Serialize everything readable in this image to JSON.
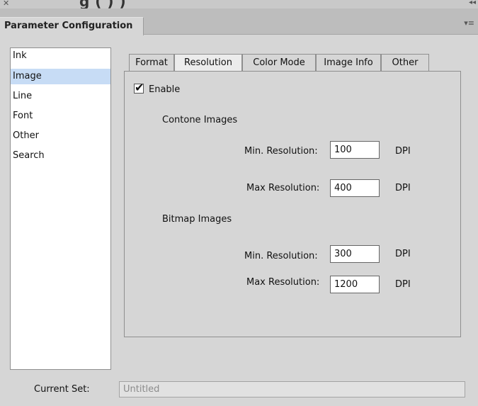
{
  "window": {
    "topstrip_cut_text": "g                                                    (   )   )",
    "panel_title": "Parameter Configuration"
  },
  "sidebar": {
    "items": [
      {
        "label": "Ink",
        "selected": false
      },
      {
        "label": "Image",
        "selected": true
      },
      {
        "label": "Line",
        "selected": false
      },
      {
        "label": "Font",
        "selected": false
      },
      {
        "label": "Other",
        "selected": false
      },
      {
        "label": "Search",
        "selected": false
      }
    ]
  },
  "tabs": [
    {
      "label": "Format",
      "active": false
    },
    {
      "label": "Resolution",
      "active": true
    },
    {
      "label": "Color Mode",
      "active": false
    },
    {
      "label": "Image Info",
      "active": false
    },
    {
      "label": "Other",
      "active": false
    }
  ],
  "content": {
    "enable_label": "Enable",
    "enable_checked": true,
    "contone_heading": "Contone Images",
    "contone_min_label": "Min. Resolution:",
    "contone_min_value": "100",
    "contone_max_label": "Max Resolution:",
    "contone_max_value": "400",
    "bitmap_heading": "Bitmap Images",
    "bitmap_min_label": "Min. Resolution:",
    "bitmap_min_value": "300",
    "bitmap_max_label": "Max Resolution:",
    "bitmap_max_value": "1200",
    "unit": "DPI"
  },
  "footer": {
    "current_set_label": "Current Set:",
    "current_set_placeholder": "Untitled"
  },
  "icons": {
    "close": "close-icon",
    "collapse": "collapse-icon",
    "panel_menu": "panel-menu-icon",
    "check": "checkmark-icon"
  }
}
